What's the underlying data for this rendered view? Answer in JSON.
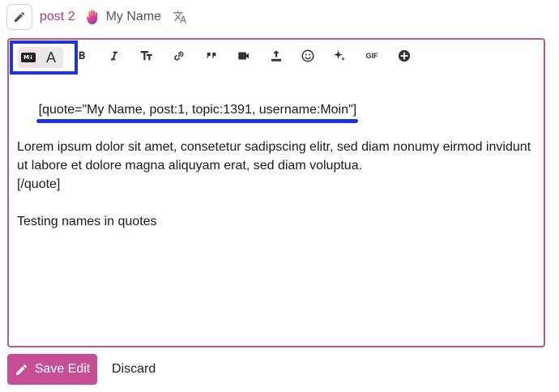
{
  "header": {
    "post_label": "post 2",
    "user_name": "My Name"
  },
  "toolbar": {
    "mode_markdown_badge": "M↓",
    "mode_rich_label": "A",
    "icons": [
      "bold-icon",
      "italic-icon",
      "heading-icon",
      "link-icon",
      "quote-icon",
      "video-icon",
      "upload-icon",
      "emoji-icon",
      "sparkle-icon",
      "gif-icon",
      "plus-circle-icon"
    ],
    "gif_label": "GIF"
  },
  "editor": {
    "lines": [
      "[quote=\"My Name, post:1, topic:1391, username:Moin\"]",
      "Lorem ipsum dolor sit amet, consetetur sadipscing elitr, sed diam nonumy eirmod invidunt ut labore et dolore magna aliquyam erat, sed diam voluptua.",
      "[/quote]",
      "",
      "Testing names in quotes"
    ]
  },
  "actions": {
    "save_label": "Save Edit",
    "discard_label": "Discard"
  },
  "colors": {
    "accent": "#c64e95",
    "border": "#b5598f",
    "highlight": "#1f33d6",
    "link": "#9b3d8d"
  }
}
